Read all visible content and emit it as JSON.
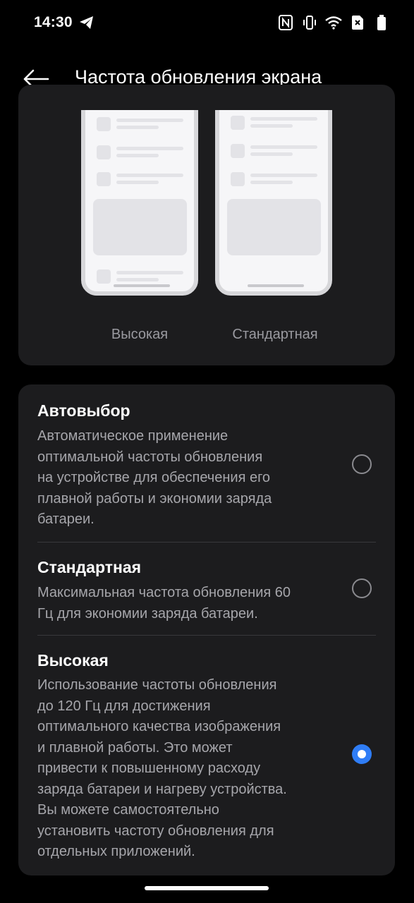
{
  "status_bar": {
    "time": "14:30",
    "icons": [
      "telegram-icon",
      "nfc-icon",
      "vibrate-icon",
      "wifi-icon",
      "no-sim-icon",
      "battery-icon"
    ]
  },
  "app_bar": {
    "title": "Частота обновления экрана",
    "back_icon": "arrow-left-icon"
  },
  "preview": {
    "left_label": "Высокая",
    "right_label": "Стандартная"
  },
  "options": [
    {
      "title": "Автовыбор",
      "description_lines": [
        "Автоматическое применение",
        "оптимальной частоты обновления",
        "на устройстве для обеспечения его",
        "плавной работы и экономии заряда",
        "батареи."
      ],
      "selected": false
    },
    {
      "title": "Стандартная",
      "description_lines": [
        "Максимальная частота обновления 60",
        "Гц для экономии заряда батареи."
      ],
      "selected": false
    },
    {
      "title": "Высокая",
      "description_lines": [
        "Использование частоты обновления",
        "до 120 Гц для достижения",
        "оптимального качества изображения",
        "и плавной работы. Это может",
        "привести к повышенному расходу",
        "заряда батареи и нагреву устройства.",
        "Вы можете самостоятельно",
        "установить частоту обновления для",
        "отдельных приложений."
      ],
      "selected": true
    }
  ],
  "colors": {
    "background": "#000000",
    "card": "#1c1c1e",
    "accent": "#2f7df6",
    "secondary_text": "#a6a6ab"
  }
}
